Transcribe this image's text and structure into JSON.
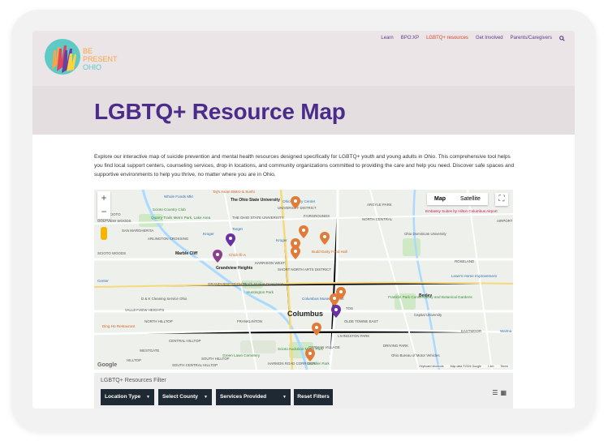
{
  "brand": {
    "line1": "BE",
    "line2": "PRESENT",
    "line3": "OHIO"
  },
  "nav": {
    "items": [
      {
        "label": "Learn"
      },
      {
        "label": "BPO:XP"
      },
      {
        "label": "LGBTQ+ resources"
      },
      {
        "label": "Get Involved"
      },
      {
        "label": "Parents/Caregivers"
      }
    ]
  },
  "page": {
    "title": "LGBTQ+ Resource Map",
    "intro": "Explore our interactive map of suicide prevention and mental health resources designed specifically for LGBTQ+ youth and young adults in Ohio. This comprehensive tool helps you find local support centers, counseling services, drop in locations, and community organizations committed to providing the care and help you need. Discover safe spaces and supportive environments to help you thrive, no matter where you are in Ohio."
  },
  "map": {
    "type_map": "Map",
    "type_satellite": "Satellite",
    "zoom_in": "+",
    "zoom_out": "−",
    "google": "Google",
    "attribution": {
      "shortcuts": "Keyboard shortcuts",
      "data": "Map data ©2024 Google",
      "scale": "1 km",
      "terms": "Terms"
    },
    "labels": {
      "osu": "The Ohio State University",
      "ohio_state": "THE OHIO STATE UNIVERSITY",
      "univ_district": "UNIVERSITY DISTRICT",
      "fairgrounds": "FAIRGROUNDS",
      "argyle": "ARGYLE PARK",
      "north_central": "NORTH CENTRAL",
      "dominican": "Ohio Dominican University",
      "airport": "AIRPORT",
      "embassy": "Embassy Suites by Hilton Columbus Airport",
      "wholefoods": "Whole Foods Mkt",
      "taj": "Taj's Asian Bistro & Sushi",
      "scioto_cc": "Scioto Country Club",
      "quarry": "Quarry Trails Metro Park, Lake Area",
      "golfview": "GOLFVIEW WOODS",
      "smargherita": "SAN MARGHERITA",
      "arlington": "ARLINGTON CROSSING",
      "kroger1": "Kroger",
      "target": "Target",
      "kroger2": "Kroger",
      "budddairy": "Budd Dairy Food Hall",
      "chickfila": "Chick-fil-A",
      "marblecliff": "Marble Cliff",
      "scioto_woods": "SCIOTO WOODS",
      "grandview": "Grandview Heights",
      "harrison": "HARRISON WEST",
      "short_north": "SHORT NORTH ARTS DISTRICT",
      "grandview_heights": "GRANDVIEW HEIGHTS",
      "nmd": "North Market Downtown",
      "huntington": "Huntington Park",
      "roseland": "ROSELAND",
      "lowes": "Lowe's Home Improvement",
      "columbus": "Columbus",
      "cma": "Columbus Museum of Art",
      "bexley": "Bexley",
      "franklinpark": "Franklin Park Conservatory and Botanical Gardens",
      "capital": "Capital University",
      "dk": "D & K Cleaning Service Ohio",
      "valleyview": "VALLEYVIEW HEIGHTS",
      "north_hilltop": "NORTH HILLTOP",
      "franklinton": "FRANKLINTON",
      "olde_towne": "OLDE TOWNE EAST",
      "livingston": "LIVINGSTON PARK",
      "driving": "DRIVING PARK",
      "eastmoor": "EASTMOOR",
      "walmart": "Walma",
      "center": "Center",
      "restaurant": "Ding Ho Restaurant",
      "central_hilltop": "CENTRAL HILLTOP",
      "westgate": "WESTGATE",
      "hilltop": "HILLTOP",
      "south_hilltop": "SOUTH HILLTOP",
      "south_central": "SOUTH CENTRAL HILLTOP",
      "greenlawn": "Green Lawn Cemetery",
      "harmon": "HARMON ROAD CORRIDOR",
      "german": "GERMAN VILLAGE",
      "scioto_aud": "Scioto Audubon Metro Park",
      "schiller": "Schiller Park",
      "motorvehicles": "Ohio Bureau of Motor Vehicles",
      "scioto_n": "T SCIOTO",
      "tos": "TOS",
      "ohio_history": "Ohio History Center"
    }
  },
  "filter": {
    "title": "LGBTQ+ Resources Filter",
    "location_type": "Location Type",
    "county": "Select County",
    "services": "Services Provided",
    "reset": "Reset Filters"
  }
}
